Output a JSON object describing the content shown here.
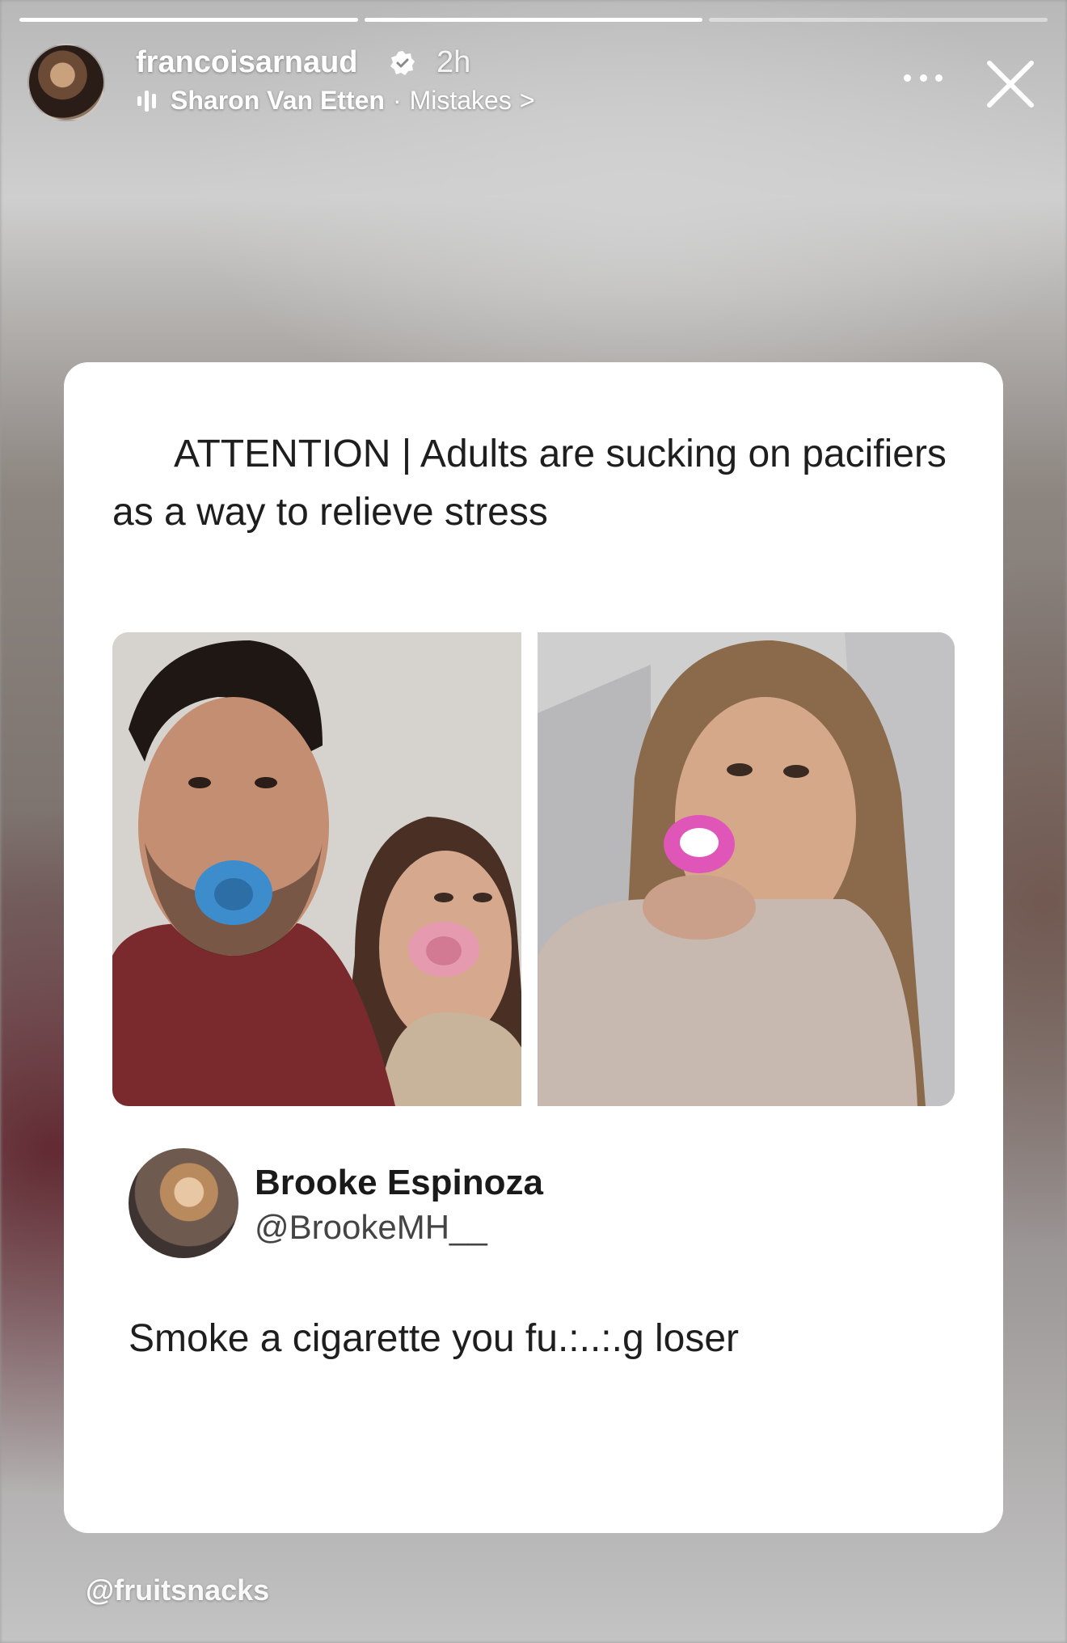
{
  "story": {
    "progress_segments": [
      1,
      1,
      0
    ],
    "username": "francoisarnaud",
    "verified": true,
    "time": "2h",
    "music": {
      "artist": "Sharon Van Etten",
      "separator": "·",
      "song": "Mistakes",
      "chevron": ">"
    }
  },
  "icons": {
    "verified": "verified-badge-icon",
    "audio": "audio-bars-icon",
    "more": "more-options-icon",
    "close": "close-icon"
  },
  "post": {
    "headline": "ATTENTION | Adults are sucking on pacifiers as a way to relieve stress",
    "photos": [
      {
        "description_icon": "photo-man-woman-pacifiers"
      },
      {
        "description_icon": "photo-woman-pacifier-selfie"
      }
    ],
    "tweet": {
      "name": "Brooke Espinoza",
      "handle": "@BrookeMH__",
      "text": "Smoke a cigarette you fu.:..:.g loser"
    }
  },
  "credit": "@fruitsnacks"
}
